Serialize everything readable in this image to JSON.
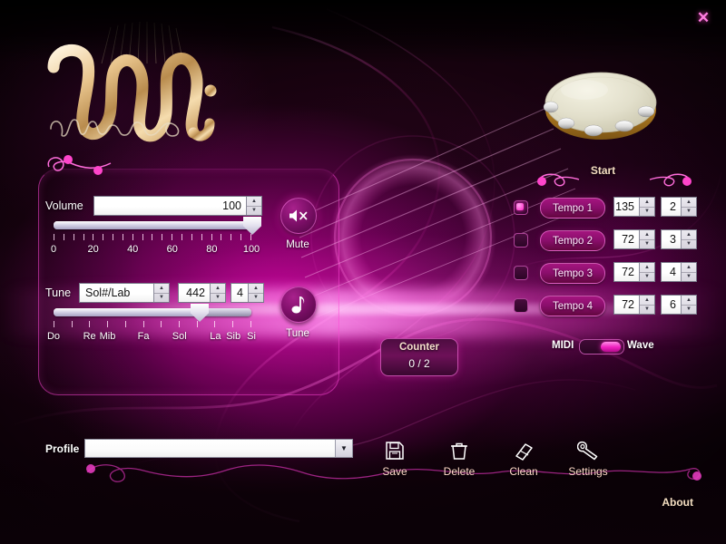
{
  "app": {
    "title": "maestro",
    "logo_wordmark": "maestro",
    "close_label": "✕"
  },
  "volume": {
    "label": "Volume",
    "value": "100",
    "slider_min": 0,
    "slider_max": 100,
    "slider_value": 100,
    "tick_count": 21,
    "tick_labels": [
      "0",
      "20",
      "40",
      "60",
      "80",
      "100"
    ],
    "mute_label": "Mute",
    "mute_icon": "speaker-mute-icon"
  },
  "tune": {
    "label": "Tune",
    "note_value": "Sol#/Lab",
    "frequency_value": "442",
    "octave_value": "4",
    "slider_min": 0,
    "slider_max": 11,
    "slider_value": 8,
    "tick_count": 12,
    "note_labels": [
      "Do",
      "Re",
      "Mib",
      "Fa",
      "Sol",
      "La",
      "Sib",
      "Si"
    ],
    "tune_label": "Tune",
    "tune_icon": "music-note-icon"
  },
  "tempo": {
    "start_label": "Start",
    "rows": [
      {
        "label": "Tempo 1",
        "bpm": "135",
        "beats": "2",
        "selected": true
      },
      {
        "label": "Tempo 2",
        "bpm": "72",
        "beats": "3",
        "selected": false
      },
      {
        "label": "Tempo 3",
        "bpm": "72",
        "beats": "4",
        "selected": false
      },
      {
        "label": "Tempo 4",
        "bpm": "72",
        "beats": "6",
        "selected": false
      }
    ]
  },
  "output": {
    "midi_label": "MIDI",
    "wave_label": "Wave",
    "selected": "Wave"
  },
  "counter": {
    "title": "Counter",
    "value": "0 / 2"
  },
  "profile": {
    "label": "Profile",
    "value": "",
    "placeholder": "",
    "dropdown_icon": "chevron-down-icon"
  },
  "toolbar": {
    "items": [
      {
        "label": "Save",
        "icon": "floppy-disk-icon"
      },
      {
        "label": "Delete",
        "icon": "trash-can-icon"
      },
      {
        "label": "Clean",
        "icon": "eraser-icon"
      },
      {
        "label": "Settings",
        "icon": "wrench-icon"
      }
    ]
  },
  "about": {
    "label": "About"
  },
  "spinner": {
    "up": "▲",
    "down": "▼"
  },
  "colors": {
    "accent_magenta": "#ff23c4",
    "panel_border": "#ff46d7",
    "cream_text": "#f3dcc0",
    "background": "#0a0106"
  }
}
